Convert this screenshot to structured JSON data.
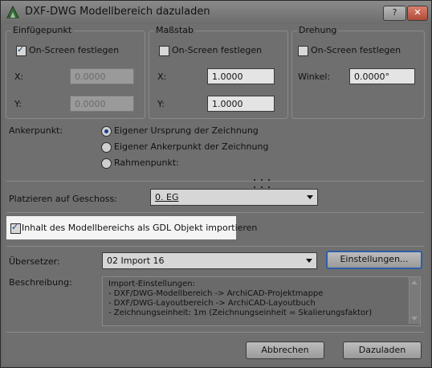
{
  "window": {
    "title": "DXF-DWG Modellbereich dazuladen",
    "help_label": "?",
    "close_label": "✕"
  },
  "einfuegepunkt": {
    "title": "Einfügepunkt",
    "onscreen_label": "On-Screen festlegen",
    "onscreen_checked": true,
    "x_label": "X:",
    "x_value": "0.0000",
    "y_label": "Y:",
    "y_value": "0.0000"
  },
  "massstab": {
    "title": "Maßstab",
    "onscreen_label": "On-Screen festlegen",
    "onscreen_checked": false,
    "x_label": "X:",
    "x_value": "1.0000",
    "y_label": "Y:",
    "y_value": "1.0000"
  },
  "drehung": {
    "title": "Drehung",
    "onscreen_label": "On-Screen festlegen",
    "onscreen_checked": false,
    "winkel_label": "Winkel:",
    "winkel_value": "0.0000°"
  },
  "ankerpunkt": {
    "label": "Ankerpunkt:",
    "options": [
      {
        "label": "Eigener Ursprung der Zeichnung",
        "selected": true
      },
      {
        "label": "Eigener Ankerpunkt der Zeichnung",
        "selected": false
      },
      {
        "label": "Rahmenpunkt:",
        "selected": false
      }
    ]
  },
  "geschoss": {
    "label": "Platzieren auf Geschoss:",
    "value": "0. EG"
  },
  "gdl": {
    "label": "Inhalt des Modellbereichs als GDL Objekt importieren",
    "checked": true
  },
  "uebersetzer": {
    "label": "Übersetzer:",
    "value": "02 Import 16",
    "einstellungen_label": "Einstellungen..."
  },
  "beschreibung": {
    "label": "Beschreibung:",
    "lines": [
      "Import-Einstellungen:",
      "- DXF/DWG-Modellbereich -> ArchiCAD-Projektmappe",
      "- DXF/DWG-Layoutbereich -> ArchiCAD-Layoutbuch",
      "- Zeichnungseinheit: 1m (Zeichnungseinheit = Skalierungsfaktor)"
    ]
  },
  "footer": {
    "abbrechen_label": "Abbrechen",
    "dazuladen_label": "Dazuladen"
  }
}
